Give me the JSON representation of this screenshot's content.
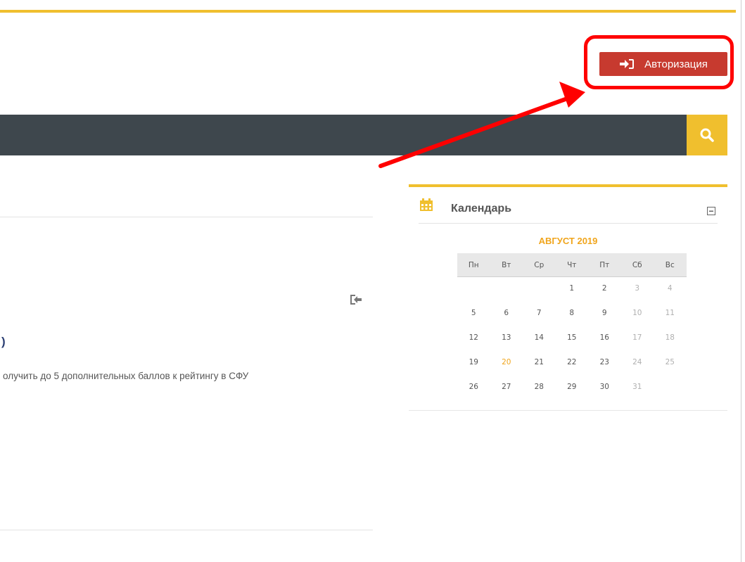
{
  "header": {
    "auth_button_label": "Авторизация",
    "auth_icon": "sign-in-icon",
    "search_icon": "search-icon"
  },
  "content": {
    "partial_heading": ")",
    "description": "олучить до 5 дополнительных баллов к рейтингу в СФУ",
    "exit_icon": "sign-out-icon"
  },
  "calendar": {
    "title": "Календарь",
    "month": "АВГУСТ 2019",
    "weekdays": [
      "Пн",
      "Вт",
      "Ср",
      "Чт",
      "Пт",
      "Сб",
      "Вс"
    ],
    "weeks": [
      [
        "",
        "",
        "",
        "1",
        "2",
        "3",
        "4"
      ],
      [
        "5",
        "6",
        "7",
        "8",
        "9",
        "10",
        "11"
      ],
      [
        "12",
        "13",
        "14",
        "15",
        "16",
        "17",
        "18"
      ],
      [
        "19",
        "20",
        "21",
        "22",
        "23",
        "24",
        "25"
      ],
      [
        "26",
        "27",
        "28",
        "29",
        "30",
        "31",
        ""
      ]
    ],
    "today": "20"
  },
  "colors": {
    "accent": "#f0bf2e",
    "nav_bg": "#3e474d",
    "auth_button": "#c73a2f",
    "annotation_red": "#ff0000",
    "month_text": "#f0a51c"
  }
}
